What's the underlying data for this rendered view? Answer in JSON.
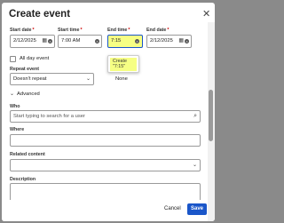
{
  "dialog": {
    "title": "Create event",
    "close_icon": "close-icon"
  },
  "fields": {
    "start_date": {
      "label": "Start date",
      "required": "*",
      "value": "2/12/2025",
      "icon": "calendar-icon"
    },
    "start_time": {
      "label": "Start time",
      "required": "*",
      "value": "7:00 AM",
      "icon": "chevron-down-icon"
    },
    "end_time": {
      "label": "End time",
      "required": "*",
      "value": "7:15",
      "icon": "clear-icon"
    },
    "end_date": {
      "label": "End date",
      "required": "*",
      "value": "2/12/2025",
      "icon": "calendar-icon"
    }
  },
  "end_time_dropdown": {
    "option_line1": "Create",
    "option_line2": "\"7:15\""
  },
  "all_day": {
    "label": "All day event",
    "checked": false
  },
  "repeat": {
    "label": "Repeat event",
    "value": "Doesn't repeat",
    "end_label": "None"
  },
  "advanced": {
    "label": "Advanced"
  },
  "who": {
    "label": "Who",
    "placeholder": "Start typing to search for a user"
  },
  "where": {
    "label": "Where",
    "value": ""
  },
  "related": {
    "label": "Related content",
    "value": ""
  },
  "description": {
    "label": "Description",
    "value": ""
  },
  "footer": {
    "cancel_label": "Cancel",
    "save_label": "Save"
  },
  "colors": {
    "accent": "#1a56c9",
    "highlight": "#f6ff84",
    "overlay": "#8a8a8a"
  }
}
